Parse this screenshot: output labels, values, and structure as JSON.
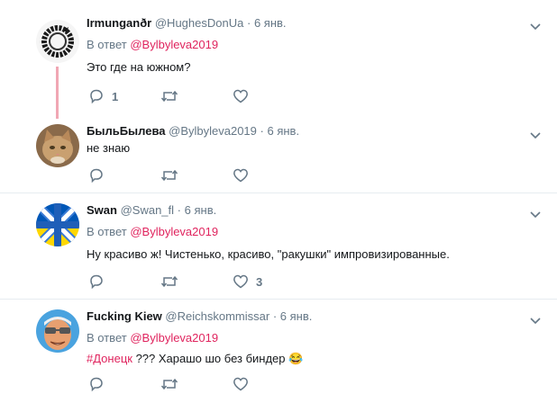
{
  "tweets": [
    {
      "name": "Irmunganðr",
      "handle": "@HughesDonUa",
      "time": "6 янв.",
      "reply_prefix": "В ответ",
      "reply_to": "@Bylbyleva2019",
      "text": "Это где на южном?",
      "reply_count": "1",
      "like_count": ""
    },
    {
      "name": "БыльБылева",
      "handle": "@Bylbyleva2019",
      "time": "6 янв.",
      "text": "не знаю",
      "reply_count": "",
      "like_count": ""
    },
    {
      "name": "Swan",
      "handle": "@Swan_fl",
      "time": "6 янв.",
      "reply_prefix": "В ответ",
      "reply_to": "@Bylbyleva2019",
      "text": "Ну красиво ж! Чистенько, красиво, \"ракушки\" импровизированные.",
      "reply_count": "",
      "like_count": "3"
    },
    {
      "name": "Fucking Kiew",
      "handle": "@Reichskommissar",
      "time": "6 янв.",
      "reply_prefix": "В ответ",
      "reply_to": "@Bylbyleva2019",
      "hashtag": "#Донецк",
      "text": " ??? Харашо шо без биндер",
      "emoji": "😂"
    }
  ],
  "separator": "·",
  "colors": {
    "accent": "#e0245e",
    "muted": "#657786",
    "thread": "#f0a7b4"
  },
  "icons": [
    "reply-icon",
    "retweet-icon",
    "like-icon",
    "chevron-down-icon"
  ]
}
